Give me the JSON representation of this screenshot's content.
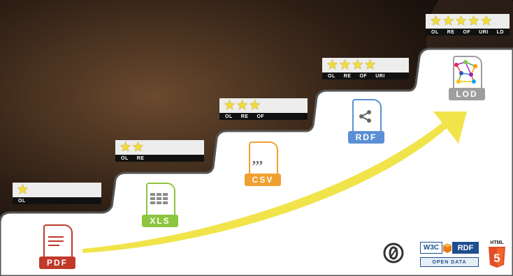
{
  "steps": [
    {
      "stars": 1,
      "codes": [
        "OL"
      ]
    },
    {
      "stars": 2,
      "codes": [
        "OL",
        "RE"
      ]
    },
    {
      "stars": 3,
      "codes": [
        "OL",
        "RE",
        "OF"
      ]
    },
    {
      "stars": 4,
      "codes": [
        "OL",
        "RE",
        "OF",
        "URI"
      ]
    },
    {
      "stars": 5,
      "codes": [
        "OL",
        "RE",
        "OF",
        "URI",
        "LD"
      ]
    }
  ],
  "formats": {
    "pdf": {
      "label": "PDF",
      "color": "#c0392b"
    },
    "xls": {
      "label": "XLS",
      "color": "#8cc63f"
    },
    "csv": {
      "label": "CSV",
      "color": "#f0a030"
    },
    "rdf": {
      "label": "RDF",
      "color": "#5b8fd4"
    },
    "lod": {
      "label": "LOD",
      "color": "#9e9e9e"
    }
  },
  "logos": {
    "w3c": "W3C",
    "rdf": "RDF",
    "open_data": "OPEN DATA",
    "html": "HTML",
    "html_num": "5"
  },
  "colors": {
    "star": "#f2dc3c",
    "arrow": "#f0e44a",
    "stair_edge": "#555555"
  }
}
